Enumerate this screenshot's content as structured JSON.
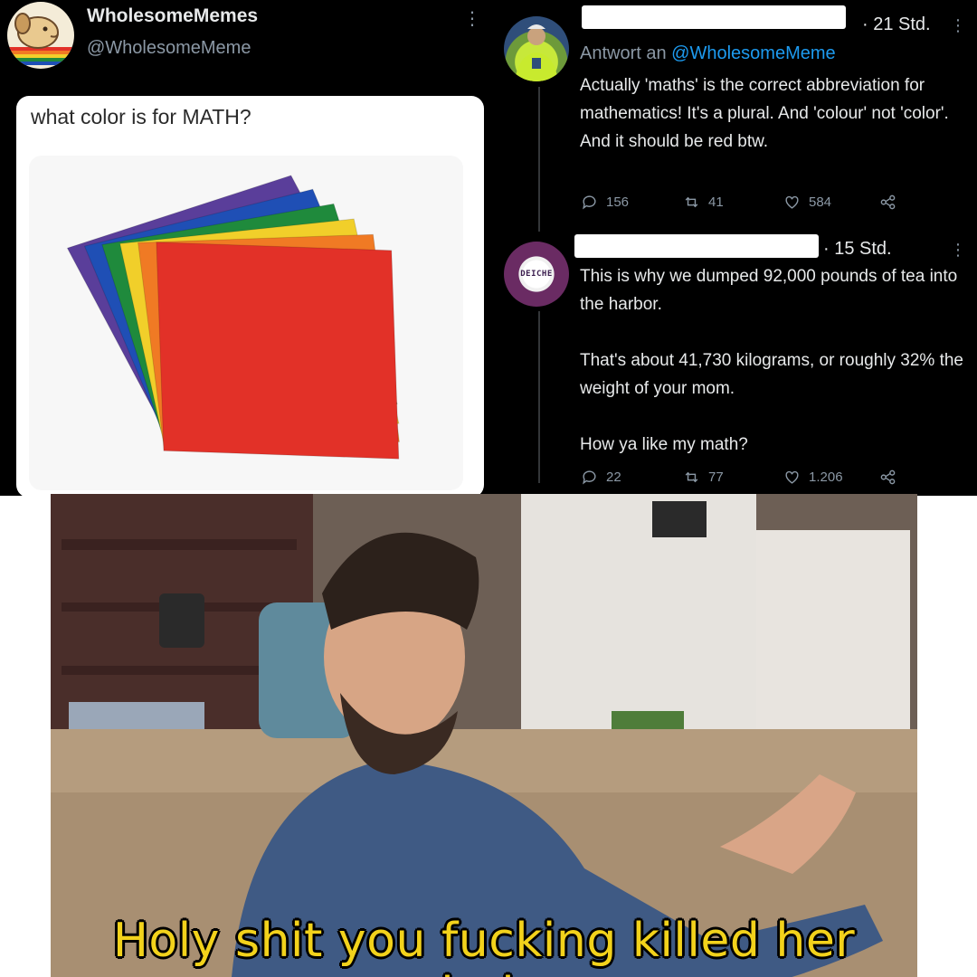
{
  "original_tweet": {
    "display_name": "WholesomeMemes",
    "handle": "@WholesomeMeme",
    "more_icon": "more-vertical-icon",
    "meme_caption": "what color is for MATH?",
    "folder_colors": [
      "#5a3e9a",
      "#1f4fb5",
      "#1f8a3c",
      "#f1cf2a",
      "#f07a24",
      "#e23128"
    ]
  },
  "reply_1": {
    "time": "· 21 Std.",
    "replying_prefix": "Antwort an",
    "replying_mention": "@WholesomeMeme",
    "text": "Actually 'maths' is the correct abbreviation for mathematics! It's a plural. And 'colour' not 'color'. And it should be red btw.",
    "replies": "156",
    "retweets": "41",
    "likes": "584"
  },
  "reply_2": {
    "avatar_text": "DEICHE",
    "time": "· 15 Std.",
    "text": "This is why we dumped 92,000 pounds of tea into the harbor.\n\nThat's about 41,730 kilograms, or roughly 32% the weight of your mom.\n\nHow ya like my math?",
    "replies": "22",
    "retweets": "77",
    "likes": "1.206"
  },
  "reaction_image": {
    "caption": "Holy shit you fucking killed her dude"
  },
  "colors": {
    "tweet_bg": "#000000",
    "text": "#e7e9ea",
    "muted": "#8b98a5",
    "mention": "#1d9bf0",
    "caption_yellow": "#f2d21b"
  }
}
